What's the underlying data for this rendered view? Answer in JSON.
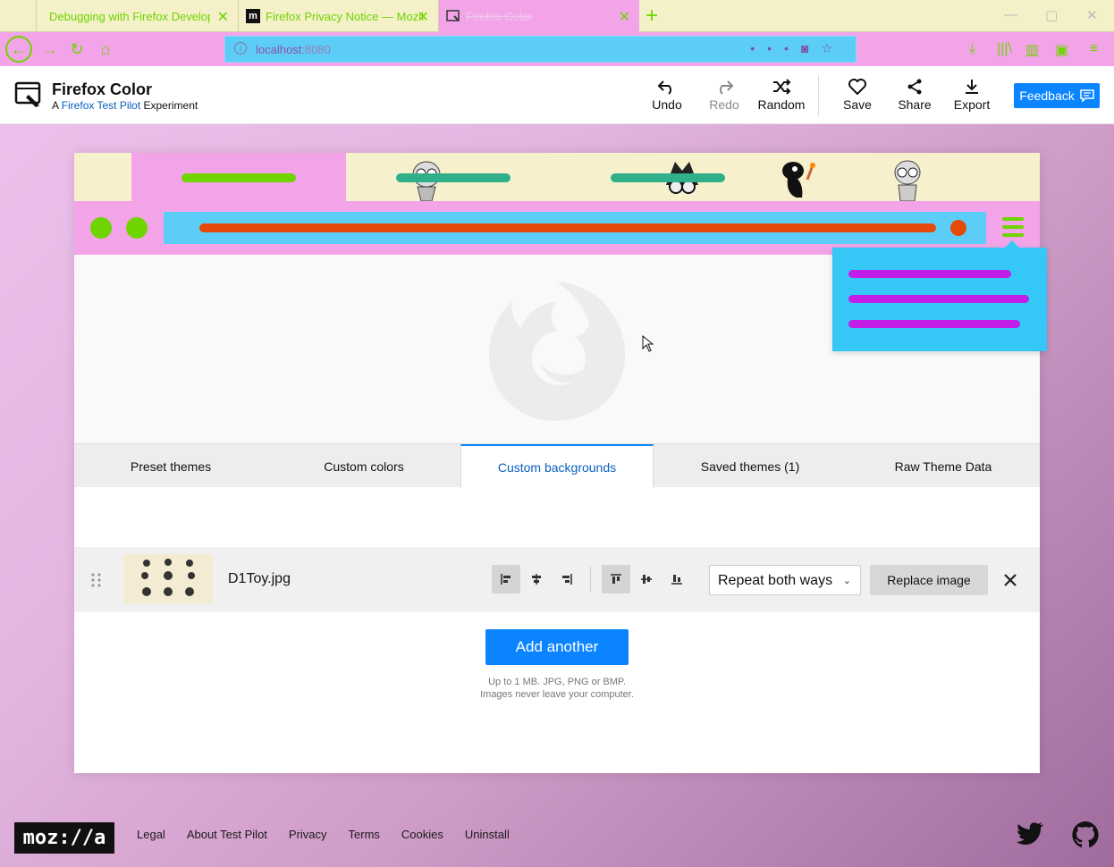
{
  "browser": {
    "tabs": [
      {
        "title": "Debugging with Firefox Developer"
      },
      {
        "title": "Firefox Privacy Notice — Mozil"
      },
      {
        "title": "Firefox Color"
      }
    ],
    "url_host": "localhost",
    "url_port": ":8080"
  },
  "app": {
    "title": "Firefox Color",
    "subtitle_prefix": "A ",
    "subtitle_link": "Firefox Test Pilot",
    "subtitle_suffix": " Experiment",
    "actions": {
      "undo": "Undo",
      "redo": "Redo",
      "random": "Random",
      "save": "Save",
      "share": "Share",
      "export": "Export"
    },
    "feedback": "Feedback"
  },
  "preview": {
    "colors": {
      "tab_bg": "#f6f0cc",
      "active_tab": "#f3a4e9",
      "toolbar": "#f3a4e9",
      "accent": "#6fd400",
      "urlbar": "#5ccdf7",
      "url_text": "#e64a0a",
      "tab_text": "#30b08a",
      "popup": "#35c7f5",
      "popup_text": "#c11ee8"
    }
  },
  "content_tabs": [
    "Preset themes",
    "Custom colors",
    "Custom backgrounds",
    "Saved themes (1)",
    "Raw Theme Data"
  ],
  "active_content_tab": "Custom backgrounds",
  "background_item": {
    "filename": "D1Toy.jpg",
    "repeat": "Repeat both ways",
    "replace": "Replace image"
  },
  "add_another": "Add another",
  "hint": {
    "line1": "Up to 1 MB. JPG, PNG or BMP.",
    "line2": "Images never leave your computer."
  },
  "footer": {
    "logo": "moz://a",
    "links": [
      "Legal",
      "About Test Pilot",
      "Privacy",
      "Terms",
      "Cookies",
      "Uninstall"
    ]
  }
}
